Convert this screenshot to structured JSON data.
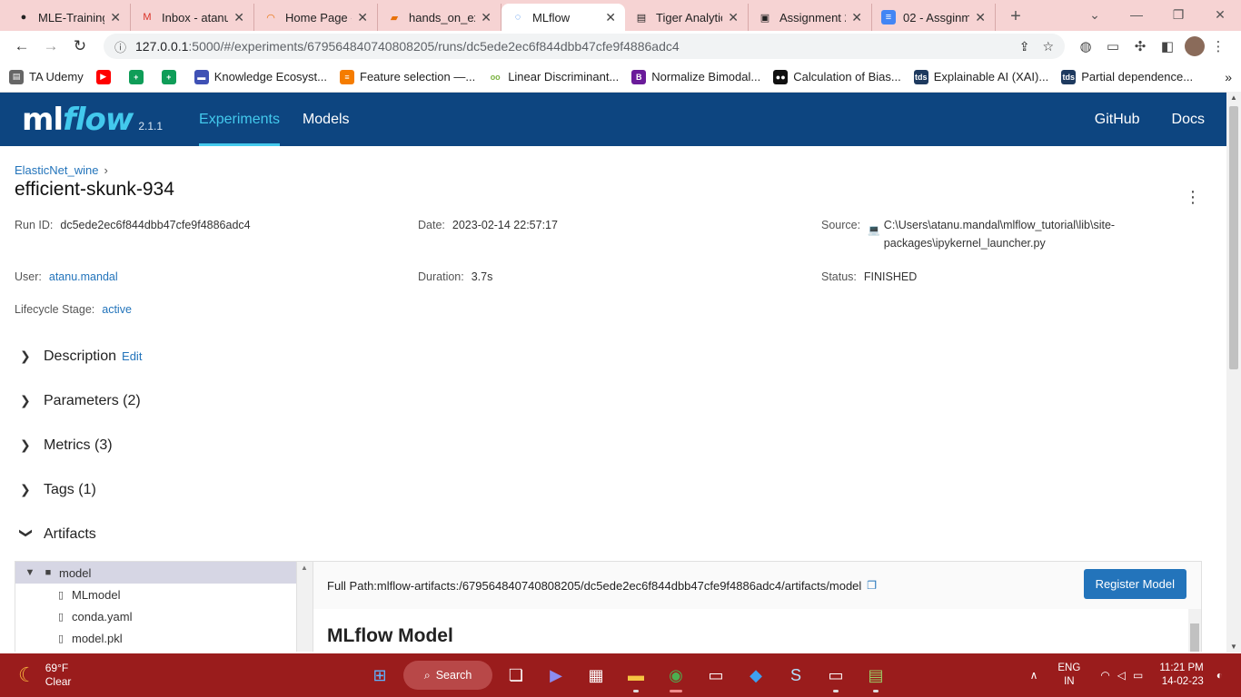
{
  "browser": {
    "tabs": [
      {
        "label": "MLE-Training",
        "icon": "github-icon",
        "color": "#222222"
      },
      {
        "label": "Inbox - atanu",
        "icon": "gmail-icon",
        "color": "#d93025"
      },
      {
        "label": "Home Page -",
        "icon": "loading-icon",
        "color": "#e8710a"
      },
      {
        "label": "hands_on_exa",
        "icon": "notebook-icon",
        "color": "#e8710a"
      },
      {
        "label": "MLflow",
        "icon": "mlflow-icon",
        "color": "#1a73e8",
        "active": true
      },
      {
        "label": "Tiger Analytic",
        "icon": "page-icon",
        "color": "#555555"
      },
      {
        "label": "Assignment 2",
        "icon": "classroom-icon",
        "color": "#333333"
      },
      {
        "label": "02 - Assginm",
        "icon": "docs-icon",
        "color": "#4285f4"
      }
    ],
    "address": {
      "host": "127.0.0.1",
      "path": ":5000/#/experiments/679564840740808205/runs/dc5ede2ec6f844dbb47cfe9f4886adc4"
    },
    "bookmarks": [
      {
        "label": "TA Udemy",
        "color": "#666666"
      },
      {
        "label": "",
        "color": "#ff0000"
      },
      {
        "label": "",
        "color": "#0f9d58"
      },
      {
        "label": "",
        "color": "#0f9d58"
      },
      {
        "label": "Knowledge Ecosyst...",
        "color": "#3f51b5"
      },
      {
        "label": "Feature selection —...",
        "color": "#f57c00"
      },
      {
        "label": "Linear Discriminant...",
        "color": "#7cb342"
      },
      {
        "label": "Normalize Bimodal...",
        "color": "#6a1b9a"
      },
      {
        "label": "Calculation of Bias...",
        "color": "#111111"
      },
      {
        "label": "Explainable AI (XAI)...",
        "color": "#1e3a5f"
      },
      {
        "label": "Partial dependence...",
        "color": "#1e3a5f"
      }
    ]
  },
  "mlflow": {
    "logo_ml": "ml",
    "logo_flow": "flow",
    "version": "2.1.1",
    "nav": {
      "experiments": "Experiments",
      "models": "Models"
    },
    "right": {
      "github": "GitHub",
      "docs": "Docs"
    }
  },
  "run": {
    "breadcrumb": "ElasticNet_wine",
    "breadcrumb_sep": "›",
    "title": "efficient-skunk-934",
    "run_id_label": "Run ID:",
    "run_id": "dc5ede2ec6f844dbb47cfe9f4886adc4",
    "date_label": "Date:",
    "date": "2023-02-14 22:57:17",
    "source_label": "Source:",
    "source_line1": "C:\\Users\\atanu.mandal\\mlflow_tutorial\\lib\\site-",
    "source_line2": "packages\\ipykernel_launcher.py",
    "user_label": "User:",
    "user": "atanu.mandal",
    "duration_label": "Duration:",
    "duration": "3.7s",
    "status_label": "Status:",
    "status": "FINISHED",
    "lifecycle_label": "Lifecycle Stage:",
    "lifecycle": "active"
  },
  "sections": {
    "description": "Description",
    "edit": "Edit",
    "parameters": "Parameters (2)",
    "metrics": "Metrics (3)",
    "tags": "Tags (1)",
    "artifacts": "Artifacts"
  },
  "artifacts": {
    "tree": [
      {
        "name": "model",
        "type": "folder"
      },
      {
        "name": "MLmodel",
        "type": "file"
      },
      {
        "name": "conda.yaml",
        "type": "file"
      },
      {
        "name": "model.pkl",
        "type": "file"
      }
    ],
    "full_path": "Full Path:mlflow-artifacts:/679564840740808205/dc5ede2ec6f844dbb47cfe9f4886adc4/artifacts/model",
    "register_button": "Register Model",
    "heading": "MLflow Model"
  },
  "taskbar": {
    "temp": "69°F",
    "condition": "Clear",
    "search": "Search",
    "lang1": "ENG",
    "lang2": "IN",
    "time": "11:21 PM",
    "date": "14-02-23"
  }
}
